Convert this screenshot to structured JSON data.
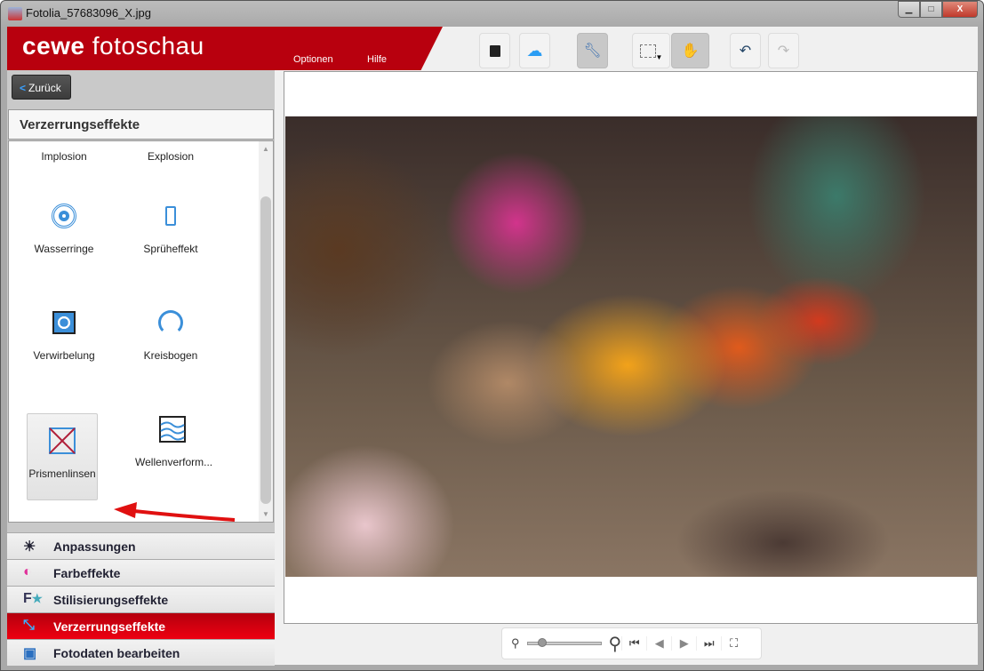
{
  "window": {
    "title": "Fotolia_57683096_X.jpg",
    "minimize": "▁",
    "maximize": "□",
    "close": "X"
  },
  "header": {
    "logo_bold": "cewe",
    "logo_light": "fotoschau",
    "menu": [
      "Optionen",
      "Hilfe"
    ]
  },
  "toolbar": {
    "save": "save-icon",
    "upload": "cloud-upload-icon",
    "tools": "wrench-icon",
    "select": "rectangle-select-icon",
    "hand": "hand-icon",
    "undo": "undo-icon",
    "redo": "redo-icon"
  },
  "left": {
    "back_label": "Zurück",
    "section_title": "Verzerrungseffekte",
    "effects": [
      {
        "label": "Implosion"
      },
      {
        "label": "Explosion"
      },
      {
        "label": "Wasserringe"
      },
      {
        "label": "Sprüheffekt"
      },
      {
        "label": "Verwirbelung"
      },
      {
        "label": "Kreisbogen"
      },
      {
        "label": "Prismenlinsen",
        "selected": true
      },
      {
        "label": "Wellenverform..."
      }
    ],
    "accordion": [
      {
        "label": "Anpassungen",
        "icon": "sun-icon"
      },
      {
        "label": "Farbeffekte",
        "icon": "palette-icon"
      },
      {
        "label": "Stilisierungseffekte",
        "icon": "font-star-icon"
      },
      {
        "label": "Verzerrungseffekte",
        "icon": "distort-icon",
        "active": true
      },
      {
        "label": "Fotodaten bearbeiten",
        "icon": "photo-data-icon"
      }
    ]
  },
  "zoom": {
    "level_fraction": 0.15
  },
  "colors": {
    "brand": "#b8000e",
    "active": "#e8000f"
  }
}
